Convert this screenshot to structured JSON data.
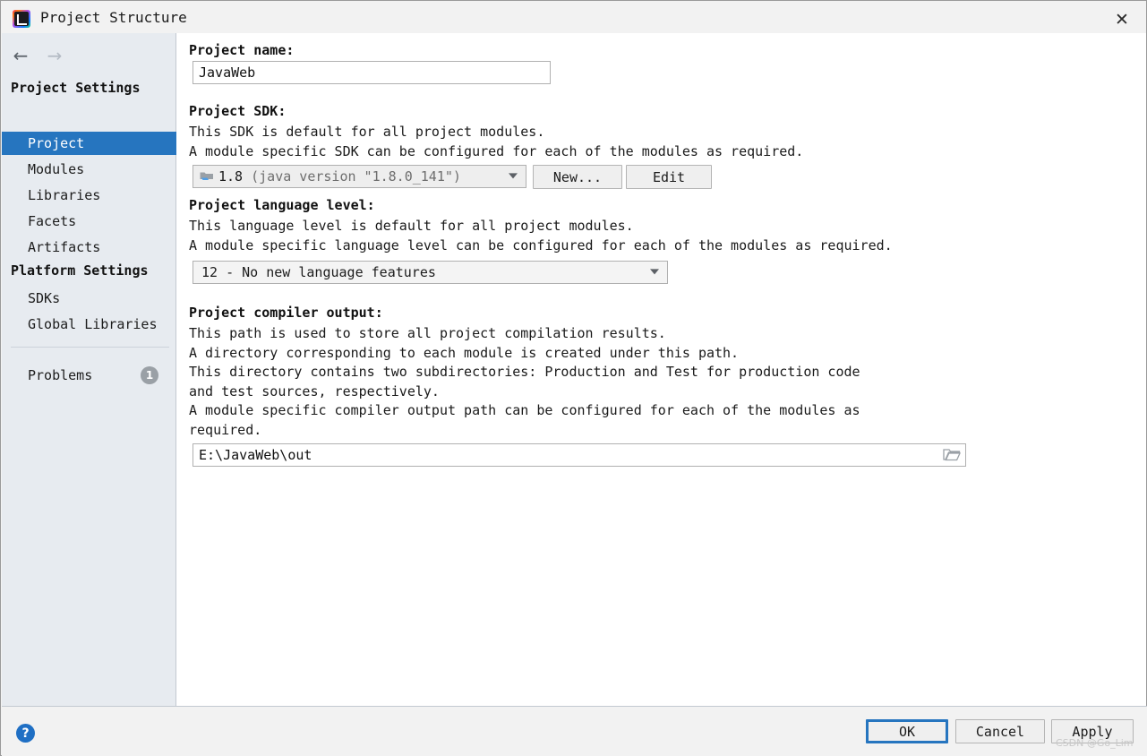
{
  "window": {
    "title": "Project Structure",
    "logo_icon": "intellij-idea-logo",
    "close_icon": "✕"
  },
  "sidebar": {
    "nav": {
      "back_icon": "←",
      "forward_icon": "→"
    },
    "groups": [
      {
        "header": "Project Settings",
        "items": [
          {
            "label": "Project",
            "selected": true
          },
          {
            "label": "Modules",
            "selected": false
          },
          {
            "label": "Libraries",
            "selected": false
          },
          {
            "label": "Facets",
            "selected": false
          },
          {
            "label": "Artifacts",
            "selected": false
          }
        ]
      },
      {
        "header": "Platform Settings",
        "items": [
          {
            "label": "SDKs",
            "selected": false
          },
          {
            "label": "Global Libraries",
            "selected": false
          }
        ]
      }
    ],
    "problems": {
      "label": "Problems",
      "count": "1"
    }
  },
  "main": {
    "project_name": {
      "label": "Project name:",
      "value": "JavaWeb"
    },
    "project_sdk": {
      "label": "Project SDK:",
      "desc_line1": "This SDK is default for all project modules.",
      "desc_line2": "A module specific SDK can be configured for each of the modules as required.",
      "selected_version": "1.8",
      "selected_detail": "(java version \"1.8.0_141\")",
      "sdk_icon": "jdk-module-icon",
      "new_button": "New...",
      "edit_button": "Edit"
    },
    "language_level": {
      "label": "Project language level:",
      "desc_line1": "This language level is default for all project modules.",
      "desc_line2": "A module specific language level can be configured for each of the modules as required.",
      "selected": "12 - No new language features"
    },
    "compiler_output": {
      "label": "Project compiler output:",
      "desc_line1": "This path is used to store all project compilation results.",
      "desc_line2": "A directory corresponding to each module is created under this path.",
      "desc_line3": "This directory contains two subdirectories: Production and Test for production code",
      "desc_line4": "and test sources, respectively.",
      "desc_line5": "A module specific compiler output path can be configured for each of the modules as",
      "desc_line6": "required.",
      "value": "E:\\JavaWeb\\out",
      "browse_icon": "folder-icon"
    }
  },
  "footer": {
    "help_icon": "?",
    "ok_button": "OK",
    "cancel_button": "Cancel",
    "apply_button": "Apply",
    "watermark": "CSDN @Go_Lim"
  },
  "colors": {
    "accent": "#2675bf",
    "sidebar_bg": "#e7ebf0",
    "help_blue": "#1f6fc4",
    "badge_gray": "#9aa0a6"
  }
}
